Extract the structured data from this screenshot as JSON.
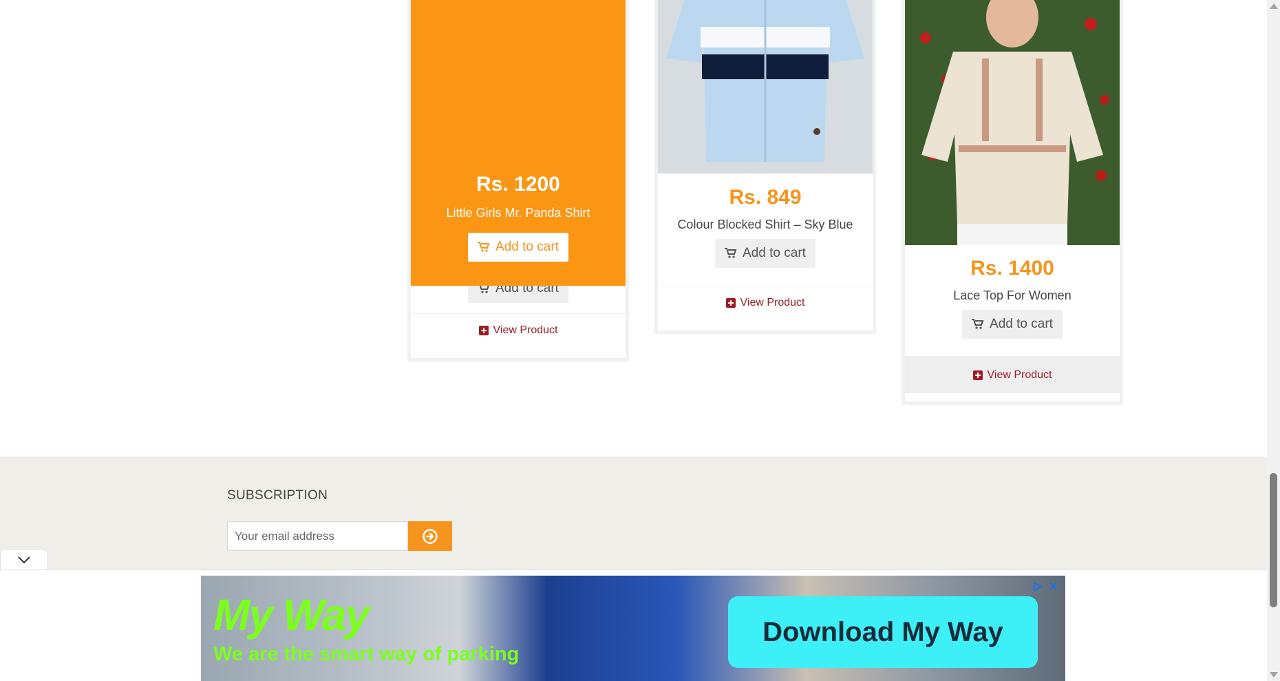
{
  "products": [
    {
      "price": "Rs. 1200",
      "name": "Little Girls Mr. Panda Shirt",
      "add_to_cart": "Add to cart",
      "view_product": "View Product",
      "hovered": true
    },
    {
      "price": "Rs. 849",
      "name": "Colour Blocked Shirt – Sky Blue",
      "add_to_cart": "Add to cart",
      "view_product": "View Product"
    },
    {
      "price": "Rs. 1400",
      "name": "Lace Top For Women",
      "add_to_cart": "Add to cart",
      "view_product": "View Product"
    }
  ],
  "subscription": {
    "title": "SUBSCRIPTION",
    "email_placeholder": "Your email address"
  },
  "ad": {
    "logo": "My Way",
    "tagline": "We are the smart way of parking",
    "cta": "Download My Way"
  },
  "colors": {
    "accent": "#f7941d",
    "hover_overlay": "#fb9514",
    "link": "#9b1c24",
    "footer_bg": "#efeee8",
    "ad_cta": "#3df0f7",
    "ad_text": "#7cff1f"
  }
}
